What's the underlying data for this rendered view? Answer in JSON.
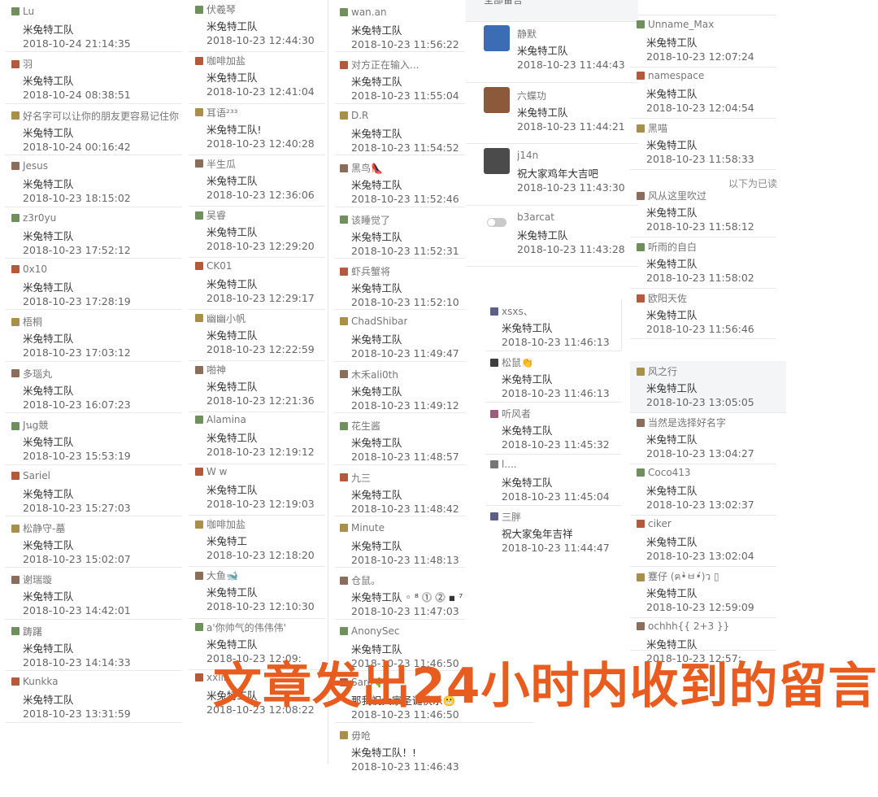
{
  "header": {
    "all_comments_label": "全部留言"
  },
  "separator_label": "以下为已读",
  "overlay_caption": "文章发出24小时内收到的留言",
  "colors": {
    "accent": "#e85d1f",
    "nickname": "#777777",
    "divider": "#e9e9e9"
  },
  "col1": [
    {
      "nickname": "Lu",
      "message": "米兔特工队",
      "time": "2018-10-24 21:14:35"
    },
    {
      "nickname": "羽",
      "message": "米兔特工队",
      "time": "2018-10-24 08:38:51"
    },
    {
      "nickname": "好名字可以让你的朋友更容易记住你",
      "message": "米兔特工队",
      "time": "2018-10-24 00:16:42"
    },
    {
      "nickname": "Jesus",
      "message": "米兔特工队",
      "time": "2018-10-23 18:15:02"
    },
    {
      "nickname": "z3r0yu",
      "message": "米兔特工队",
      "time": "2018-10-23 17:52:12"
    },
    {
      "nickname": "0x10",
      "message": "米兔特工队",
      "time": "2018-10-23 17:28:19"
    },
    {
      "nickname": "梧桐",
      "message": "米兔特工队",
      "time": "2018-10-23 17:03:12"
    },
    {
      "nickname": "多瑙丸",
      "message": "米兔特工队",
      "time": "2018-10-23 16:07:23"
    },
    {
      "nickname": "Jนg競",
      "message": "米兔特工队",
      "time": "2018-10-23 15:53:19"
    },
    {
      "nickname": "Sariel",
      "message": "米兔特工队",
      "time": "2018-10-23 15:27:03"
    },
    {
      "nickname": "松静守-墓",
      "message": "米兔特工队",
      "time": "2018-10-23 15:02:07"
    },
    {
      "nickname": "谢瑞璇",
      "message": "米兔特工队",
      "time": "2018-10-23 14:42:01"
    },
    {
      "nickname": "踌躇",
      "message": "米兔特工队",
      "time": "2018-10-23 14:14:33"
    },
    {
      "nickname": "Kunkka",
      "message": "米兔特工队",
      "time": "2018-10-23 13:31:59"
    }
  ],
  "col2": [
    {
      "nickname": "伏羲琴",
      "message": "米兔特工队",
      "time": "2018-10-23 12:44:30"
    },
    {
      "nickname": "咖啡加盐",
      "message": "米兔特工队",
      "time": "2018-10-23 12:41:04"
    },
    {
      "nickname": "耳语²³³",
      "message": "米兔特工队!",
      "time": "2018-10-23 12:40:28"
    },
    {
      "nickname": "半生瓜",
      "message": "米兔特工队",
      "time": "2018-10-23 12:36:06"
    },
    {
      "nickname": "吴睿",
      "message": "米兔特工队",
      "time": "2018-10-23 12:29:20"
    },
    {
      "nickname": "CK01",
      "message": "米兔特工队",
      "time": "2018-10-23 12:29:17"
    },
    {
      "nickname": "幽幽小帆",
      "message": "米兔特工队",
      "time": "2018-10-23 12:22:59"
    },
    {
      "nickname": "啪神",
      "message": "米兔特工队",
      "time": "2018-10-23 12:21:36"
    },
    {
      "nickname": "Alamina",
      "message": "米兔特工队",
      "time": "2018-10-23 12:19:12"
    },
    {
      "nickname": "W w",
      "message": "米兔特工队",
      "time": "2018-10-23 12:19:03"
    },
    {
      "nickname": "咖啡加盐",
      "message": "米兔特工",
      "time": "2018-10-23 12:18:20"
    },
    {
      "nickname": "大鱼🐋",
      "message": "米兔特工队",
      "time": "2018-10-23 12:10:30"
    },
    {
      "nickname": "a'你帅气的伟伟伟'",
      "message": "米兔特工队",
      "time": "2018-10-23 12:09:"
    },
    {
      "nickname": "xxlin",
      "message": "米兔特工队",
      "time": "2018-10-23 12:08:22"
    }
  ],
  "col3": [
    {
      "nickname": "wan.an",
      "message": "米兔特工队",
      "time": "2018-10-23 11:56:22"
    },
    {
      "nickname": "对方正在输入...",
      "message": "米兔特工队",
      "time": "2018-10-23 11:55:04"
    },
    {
      "nickname": "D.R",
      "message": "米兔特工队",
      "time": "2018-10-23 11:54:52"
    },
    {
      "nickname": "黑鸟👠",
      "message": "米兔特工队",
      "time": "2018-10-23 11:52:46"
    },
    {
      "nickname": "该睡觉了",
      "message": "米兔特工队",
      "time": "2018-10-23 11:52:31"
    },
    {
      "nickname": "虾兵蟹将",
      "message": "米兔特工队",
      "time": "2018-10-23 11:52:10"
    },
    {
      "nickname": "ChadShibar",
      "message": "米兔特工队",
      "time": "2018-10-23 11:49:47"
    },
    {
      "nickname": "木禾ali0th",
      "message": "米兔特工队",
      "time": "2018-10-23 11:49:12"
    },
    {
      "nickname": "花生酱",
      "message": "米兔特工队",
      "time": "2018-10-23 11:48:57"
    },
    {
      "nickname": "九三",
      "message": "米兔特工队",
      "time": "2018-10-23 11:48:42"
    },
    {
      "nickname": "Minute",
      "message": "米兔特工队",
      "time": "2018-10-23 11:48:13"
    },
    {
      "nickname": "仓鼠。",
      "message": "米兔特工队 ◦ ⁸ ⓵ ⓶ ▪ ⁷",
      "time": "2018-10-23 11:47:03"
    },
    {
      "nickname": "AnonySec",
      "message": "米兔特工队",
      "time": "2018-10-23 11:46:50"
    },
    {
      "nickname": "Saro🌵",
      "message": "那我祝大家圣诞快乐😬",
      "time": "2018-10-23 11:46:50"
    },
    {
      "nickname": "毋呛",
      "message": "米兔特工队！!",
      "time": "2018-10-23 11:46:43"
    }
  ],
  "col4_top": [
    {
      "nickname": "静默",
      "message": "米兔特工队",
      "time": "2018-10-23 11:44:43"
    },
    {
      "nickname": "六蝶功",
      "message": "米兔特工队",
      "time": "2018-10-23 11:44:21"
    },
    {
      "nickname": "j14n",
      "message": "祝大家鸡年大吉吧",
      "time": "2018-10-23 11:43:30"
    },
    {
      "nickname": "b3arcat",
      "message": "米兔特工队",
      "time": "2018-10-23 11:43:28"
    }
  ],
  "col4_bottom": [
    {
      "nickname": "xsxs、",
      "message": "米兔特工队",
      "time": "2018-10-23 11:46:13"
    },
    {
      "nickname": "松鼠👏",
      "message": "米兔特工队",
      "time": "2018-10-23 11:46:13"
    },
    {
      "nickname": "听风者",
      "message": "米兔特工队",
      "time": "2018-10-23 11:45:32"
    },
    {
      "nickname": "l....",
      "message": "米兔特工队",
      "time": "2018-10-23 11:45:04"
    },
    {
      "nickname": "三胖",
      "message": "祝大家兔年吉祥",
      "time": "2018-10-23 11:44:47"
    }
  ],
  "col5": [
    {
      "nickname": "Unname_Max",
      "message": "米兔特工队",
      "time": "2018-10-23 12:07:24"
    },
    {
      "nickname": "namespace",
      "message": "米兔特工队",
      "time": "2018-10-23 12:04:54"
    },
    {
      "nickname": "黑喵",
      "message": "米兔特工队",
      "time": "2018-10-23 11:58:33"
    },
    {
      "nickname": "风从这里吹过",
      "message": "米兔特工队",
      "time": "2018-10-23 11:58:12"
    },
    {
      "nickname": "听雨的自白",
      "message": "米兔特工队",
      "time": "2018-10-23 11:58:02"
    },
    {
      "nickname": "欧阳天佐",
      "message": "米兔特工队",
      "time": "2018-10-23 11:56:46"
    },
    {
      "nickname": "风之行",
      "message": "米兔特工队",
      "time": "2018-10-23 13:05:05"
    },
    {
      "nickname": "当然是选择好名字",
      "message": "米兔特工队",
      "time": "2018-10-23 13:04:27"
    },
    {
      "nickname": "Coco413",
      "message": "米兔特工队",
      "time": "2018-10-23 13:02:37"
    },
    {
      "nickname": "ciker",
      "message": "米兔特工队",
      "time": "2018-10-23 13:02:04"
    },
    {
      "nickname": "蹇仔 (ฅ•̀ㅂ•́)ว ▯",
      "message": "米兔特工队",
      "time": "2018-10-23 12:59:09"
    },
    {
      "nickname": "ochhh{{ 2+3 }}",
      "message": "米兔特工队",
      "time": "2018-10-23 12:57:"
    }
  ]
}
